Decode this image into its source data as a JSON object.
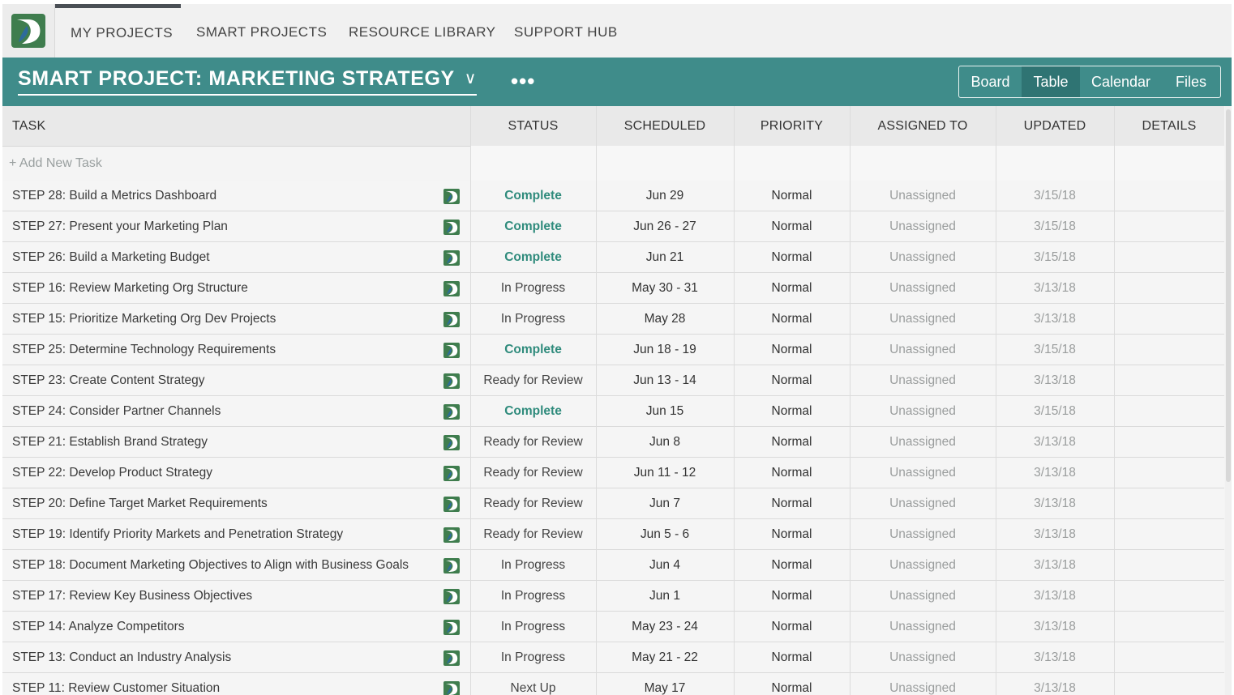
{
  "nav": {
    "items": [
      "MY PROJECTS",
      "SMART PROJECTS",
      "RESOURCE LIBRARY",
      "SUPPORT HUB"
    ]
  },
  "project": {
    "title": "SMART PROJECT: MARKETING STRATEGY",
    "chevron": "∨",
    "more": "•••",
    "views": [
      "Board",
      "Table",
      "Calendar",
      "Files"
    ],
    "active_view": "Table"
  },
  "table": {
    "headers": {
      "task": "TASK",
      "status": "STATUS",
      "scheduled": "SCHEDULED",
      "priority": "PRIORITY",
      "assigned": "ASSIGNED TO",
      "updated": "UPDATED",
      "details": "DETAILS"
    },
    "add_task": "+ Add New Task",
    "rows": [
      {
        "task": "STEP 28: Build a Metrics Dashboard",
        "status": "Complete",
        "scheduled": "Jun 29",
        "priority": "Normal",
        "assigned": "Unassigned",
        "updated": "3/15/18"
      },
      {
        "task": "STEP 27: Present your Marketing Plan",
        "status": "Complete",
        "scheduled": "Jun 26 - 27",
        "priority": "Normal",
        "assigned": "Unassigned",
        "updated": "3/15/18"
      },
      {
        "task": "STEP 26: Build a Marketing Budget",
        "status": "Complete",
        "scheduled": "Jun 21",
        "priority": "Normal",
        "assigned": "Unassigned",
        "updated": "3/15/18"
      },
      {
        "task": "STEP 16: Review Marketing Org Structure",
        "status": "In Progress",
        "scheduled": "May 30 - 31",
        "priority": "Normal",
        "assigned": "Unassigned",
        "updated": "3/13/18"
      },
      {
        "task": "STEP 15: Prioritize Marketing Org Dev Projects",
        "status": "In Progress",
        "scheduled": "May 28",
        "priority": "Normal",
        "assigned": "Unassigned",
        "updated": "3/13/18"
      },
      {
        "task": "STEP 25: Determine Technology Requirements",
        "status": "Complete",
        "scheduled": "Jun 18 - 19",
        "priority": "Normal",
        "assigned": "Unassigned",
        "updated": "3/15/18"
      },
      {
        "task": "STEP 23: Create Content Strategy",
        "status": "Ready for Review",
        "scheduled": "Jun 13 - 14",
        "priority": "Normal",
        "assigned": "Unassigned",
        "updated": "3/13/18"
      },
      {
        "task": "STEP 24: Consider Partner Channels",
        "status": "Complete",
        "scheduled": "Jun 15",
        "priority": "Normal",
        "assigned": "Unassigned",
        "updated": "3/15/18"
      },
      {
        "task": "STEP 21: Establish Brand Strategy",
        "status": "Ready for Review",
        "scheduled": "Jun 8",
        "priority": "Normal",
        "assigned": "Unassigned",
        "updated": "3/13/18"
      },
      {
        "task": "STEP 22: Develop Product Strategy",
        "status": "Ready for Review",
        "scheduled": "Jun 11 - 12",
        "priority": "Normal",
        "assigned": "Unassigned",
        "updated": "3/13/18"
      },
      {
        "task": "STEP 20: Define Target Market Requirements",
        "status": "Ready for Review",
        "scheduled": "Jun 7",
        "priority": "Normal",
        "assigned": "Unassigned",
        "updated": "3/13/18"
      },
      {
        "task": "STEP 19: Identify Priority Markets and Penetration Strategy",
        "status": "Ready for Review",
        "scheduled": "Jun 5 - 6",
        "priority": "Normal",
        "assigned": "Unassigned",
        "updated": "3/13/18"
      },
      {
        "task": "STEP 18: Document Marketing Objectives to Align with Business Goals",
        "status": "In Progress",
        "scheduled": "Jun 4",
        "priority": "Normal",
        "assigned": "Unassigned",
        "updated": "3/13/18"
      },
      {
        "task": "STEP 17: Review Key Business Objectives",
        "status": "In Progress",
        "scheduled": "Jun 1",
        "priority": "Normal",
        "assigned": "Unassigned",
        "updated": "3/13/18"
      },
      {
        "task": "STEP 14: Analyze Competitors",
        "status": "In Progress",
        "scheduled": "May 23 - 24",
        "priority": "Normal",
        "assigned": "Unassigned",
        "updated": "3/13/18"
      },
      {
        "task": "STEP 13: Conduct an Industry Analysis",
        "status": "In Progress",
        "scheduled": "May 21 - 22",
        "priority": "Normal",
        "assigned": "Unassigned",
        "updated": "3/13/18"
      },
      {
        "task": "STEP 11: Review Customer Situation",
        "status": "Next Up",
        "scheduled": "May 17",
        "priority": "Normal",
        "assigned": "Unassigned",
        "updated": "3/13/18"
      }
    ]
  },
  "colors": {
    "header_teal": "#3f8c8a",
    "complete_green": "#2f8b7c",
    "logo_green": "#3f7d4e"
  },
  "icons": {
    "logo": "brand-logo-icon",
    "task_row": "task-type-icon",
    "chevron": "chevron-down-icon",
    "more": "more-options-icon"
  }
}
